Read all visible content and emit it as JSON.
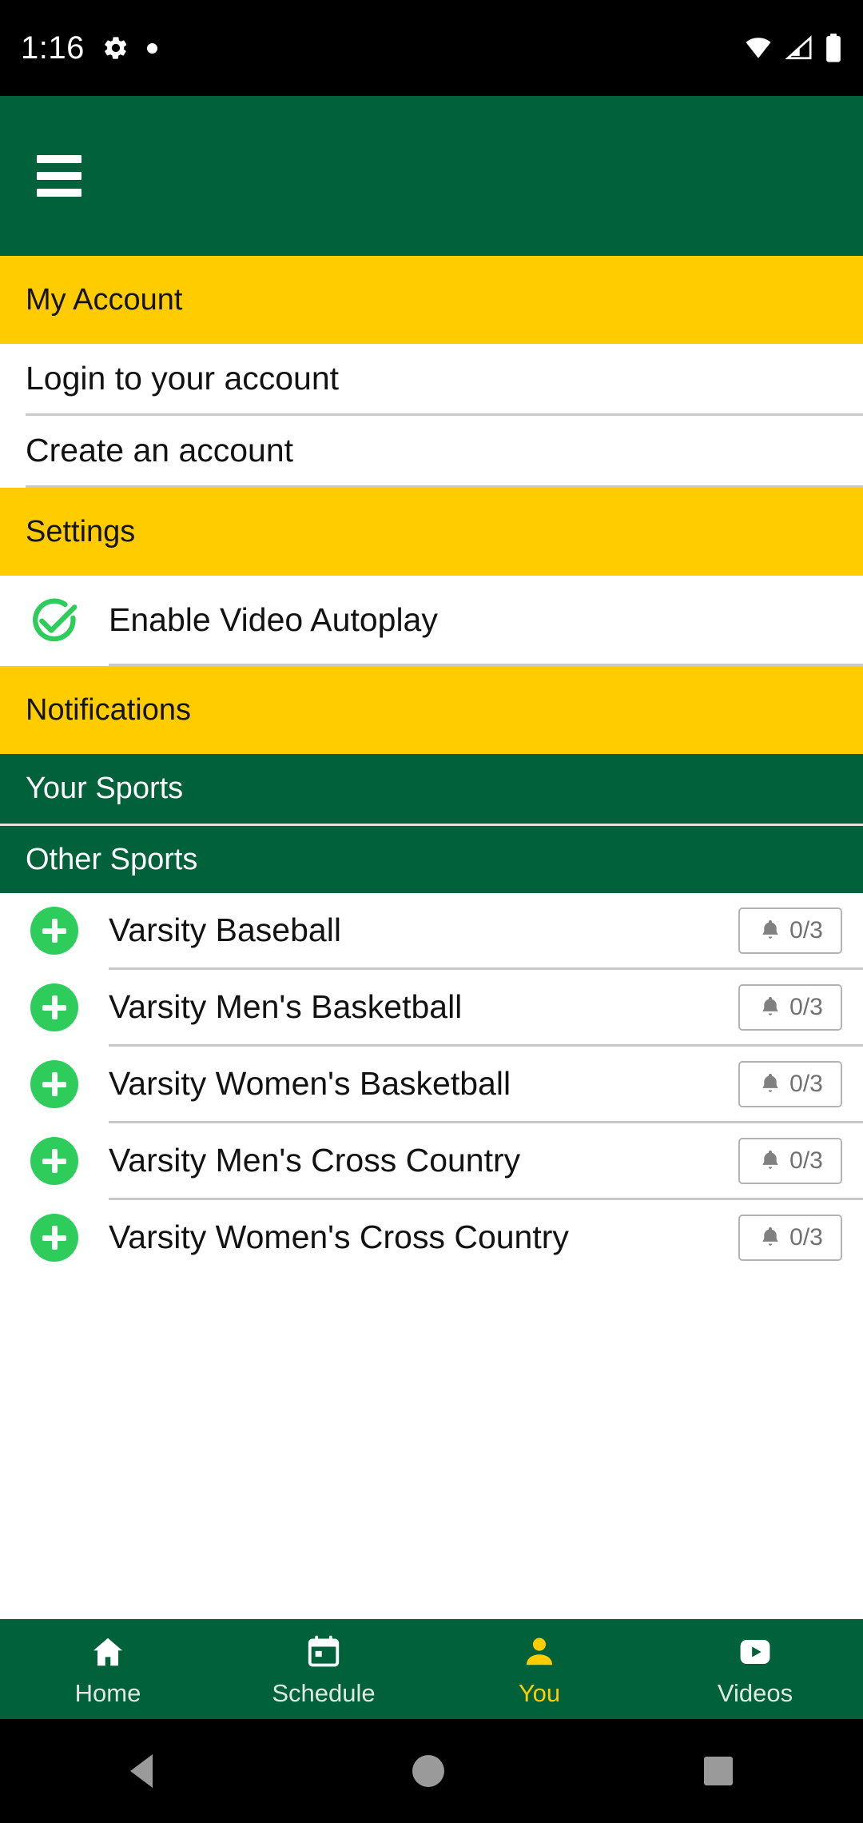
{
  "status_bar": {
    "time": "1:16",
    "left_icons": [
      "gear-icon",
      "dot-icon"
    ],
    "right_icons": [
      "wifi-icon",
      "cell-signal-icon",
      "battery-icon"
    ]
  },
  "app_bar": {
    "menu_icon": "hamburger-menu-icon"
  },
  "colors": {
    "brand_green": "#00613a",
    "brand_yellow": "#ffcc00",
    "accent_green": "#2ecc5b",
    "badge_border": "#b4b4b4",
    "divider": "#c9c9c9"
  },
  "sections": {
    "my_account": {
      "title": "My Account",
      "items": [
        {
          "label": "Login to your account"
        },
        {
          "label": "Create an account"
        }
      ]
    },
    "settings": {
      "title": "Settings",
      "items": [
        {
          "label": "Enable Video Autoplay",
          "icon": "check-circle-icon",
          "checked": true
        }
      ]
    },
    "notifications": {
      "title": "Notifications",
      "your_sports": "Your Sports",
      "other_sports": "Other Sports",
      "sports": [
        {
          "name": "Varsity Baseball",
          "count": "0/3",
          "add_icon": "plus-circle-icon",
          "bell_icon": "bell-icon"
        },
        {
          "name": "Varsity Men's Basketball",
          "count": "0/3",
          "add_icon": "plus-circle-icon",
          "bell_icon": "bell-icon"
        },
        {
          "name": "Varsity Women's Basketball",
          "count": "0/3",
          "add_icon": "plus-circle-icon",
          "bell_icon": "bell-icon"
        },
        {
          "name": "Varsity Men's Cross Country",
          "count": "0/3",
          "add_icon": "plus-circle-icon",
          "bell_icon": "bell-icon"
        },
        {
          "name": "Varsity Women's Cross Country",
          "count": "0/3",
          "add_icon": "plus-circle-icon",
          "bell_icon": "bell-icon"
        }
      ]
    }
  },
  "bottom_nav": {
    "items": [
      {
        "label": "Home",
        "icon": "home-icon",
        "active": false
      },
      {
        "label": "Schedule",
        "icon": "calendar-icon",
        "active": false
      },
      {
        "label": "You",
        "icon": "person-icon",
        "active": true
      },
      {
        "label": "Videos",
        "icon": "video-play-icon",
        "active": false
      }
    ]
  },
  "android_nav": {
    "back": "back-triangle-icon",
    "home": "home-circle-icon",
    "recents": "recents-square-icon"
  }
}
